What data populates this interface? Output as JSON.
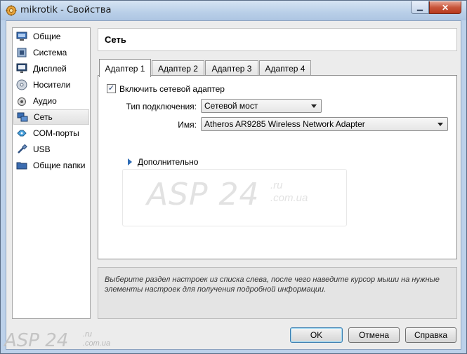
{
  "window": {
    "title": "mikrotik - Свойства",
    "minimize_glyph": "▁",
    "close_glyph": "✕"
  },
  "sidebar": {
    "items": [
      {
        "label": "Общие",
        "icon": "general-icon"
      },
      {
        "label": "Система",
        "icon": "system-icon"
      },
      {
        "label": "Дисплей",
        "icon": "display-icon"
      },
      {
        "label": "Носители",
        "icon": "storage-icon"
      },
      {
        "label": "Аудио",
        "icon": "audio-icon"
      },
      {
        "label": "Сеть",
        "icon": "network-icon",
        "selected": true
      },
      {
        "label": "COM-порты",
        "icon": "com-port-icon"
      },
      {
        "label": "USB",
        "icon": "usb-icon"
      },
      {
        "label": "Общие папки",
        "icon": "shared-folder-icon"
      }
    ]
  },
  "header": {
    "title": "Сеть"
  },
  "tabs": [
    {
      "label": "Адаптер 1",
      "active": true
    },
    {
      "label": "Адаптер 2"
    },
    {
      "label": "Адаптер 3"
    },
    {
      "label": "Адаптер 4"
    }
  ],
  "adapter": {
    "enable_label": "Включить сетевой адаптер",
    "enable_checked": "✓",
    "attachment_label": "Тип подключения:",
    "attachment_value": "Сетевой мост",
    "name_label": "Имя:",
    "name_value": "Atheros AR9285 Wireless Network Adapter",
    "advanced_label": "Дополнительно"
  },
  "watermark": {
    "main": "ASP 24",
    "ru": ".ru",
    "com": ".com.ua"
  },
  "info": {
    "text": "Выберите раздел настроек из списка слева, после чего наведите курсор мыши на нужные элементы настроек для получения подробной информации."
  },
  "buttons": {
    "ok": "OK",
    "cancel": "Отмена",
    "help": "Справка"
  },
  "colors": {
    "accent": "#2d6bb5",
    "titlebar": "#b9cfe8"
  }
}
